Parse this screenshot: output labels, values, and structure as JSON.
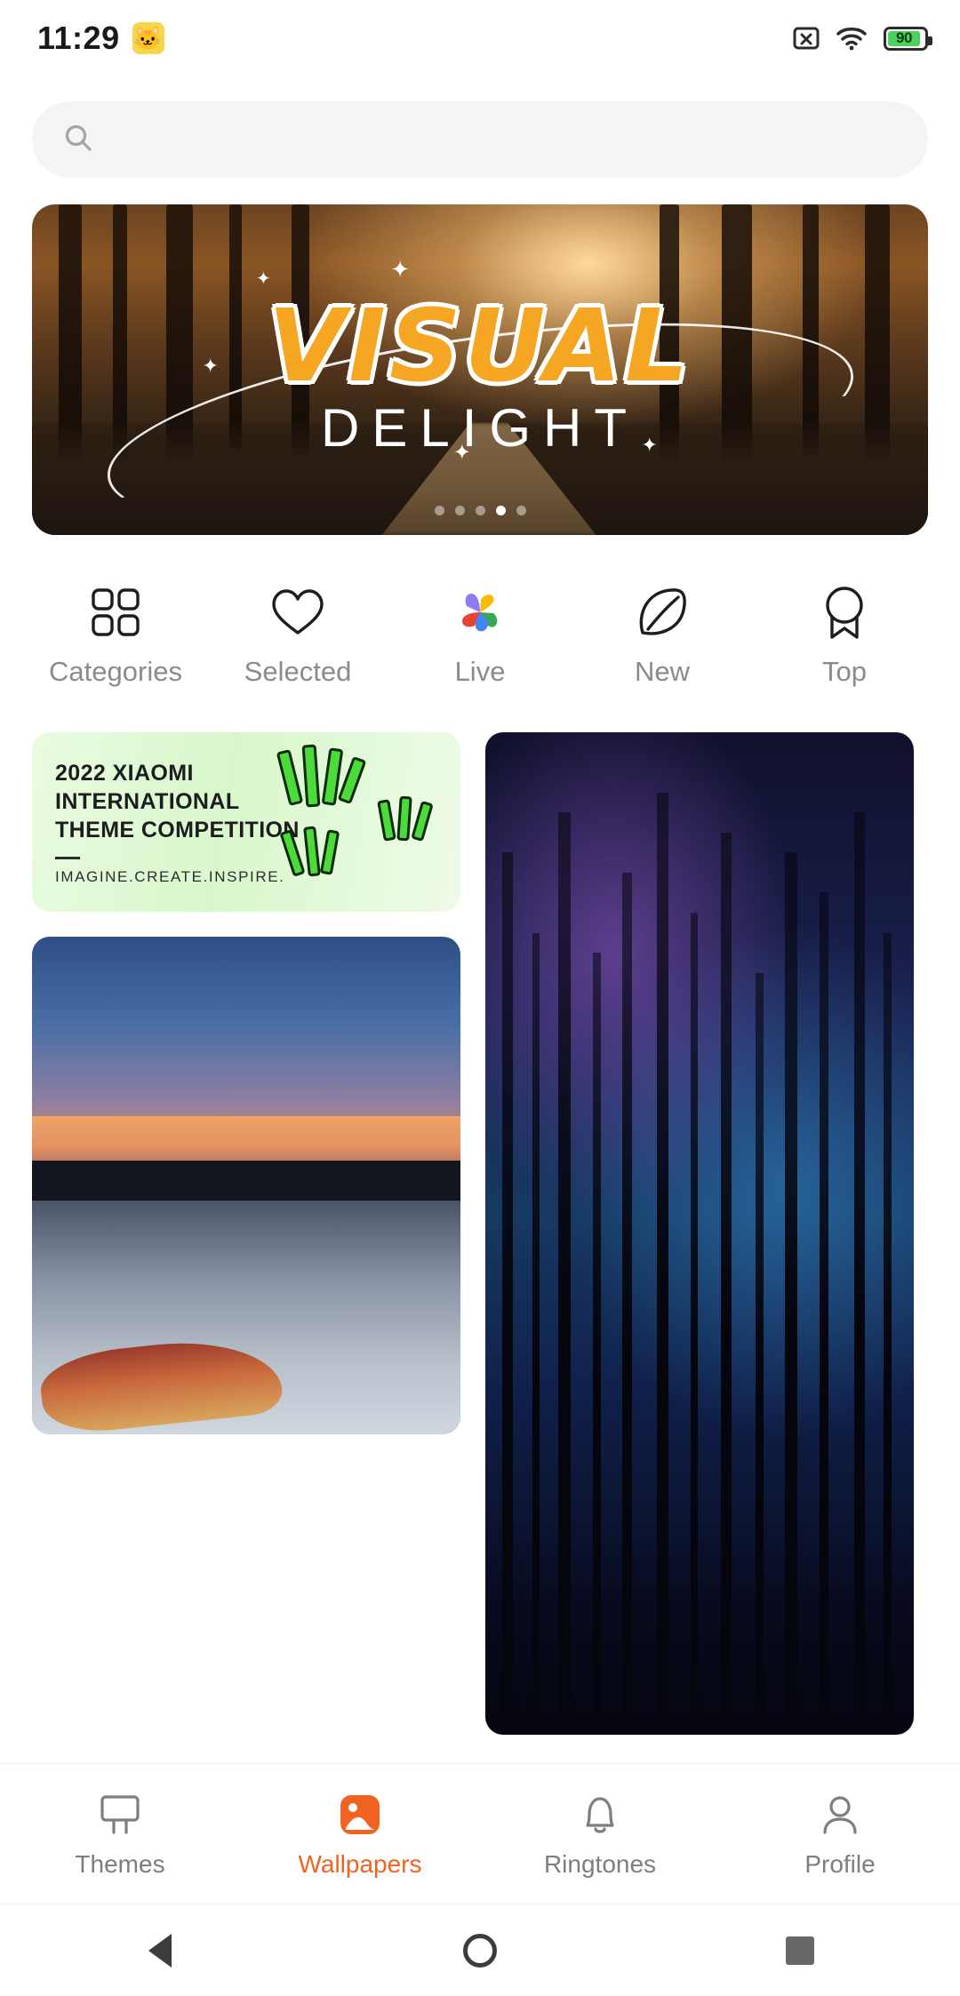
{
  "status_bar": {
    "time": "11:29",
    "emoji": "🐱",
    "battery_percent": "90",
    "icons": [
      "x-box-icon",
      "wifi-icon",
      "battery-icon"
    ]
  },
  "search": {
    "placeholder": "",
    "icon": "search-icon"
  },
  "banner": {
    "title_line1": "VISUAL",
    "title_line2": "DELIGHT",
    "dots_total": 5,
    "active_dot": 4
  },
  "categories": [
    {
      "label": "Categories",
      "icon": "grid-four-icon"
    },
    {
      "label": "Selected",
      "icon": "heart-icon"
    },
    {
      "label": "Live",
      "icon": "pinwheel-color-icon"
    },
    {
      "label": "New",
      "icon": "leaf-icon"
    },
    {
      "label": "Top",
      "icon": "ribbon-badge-icon"
    }
  ],
  "promo": {
    "title": "2022 XIAOMI INTERNATIONAL THEME COMPETITION",
    "subtitle": "IMAGINE.CREATE.INSPIRE."
  },
  "cards": [
    {
      "name": "lake-kayak-wallpaper"
    },
    {
      "name": "night-forest-wallpaper"
    }
  ],
  "bottom_nav": [
    {
      "label": "Themes",
      "icon": "themes-icon",
      "active": false
    },
    {
      "label": "Wallpapers",
      "icon": "wallpapers-icon",
      "active": true
    },
    {
      "label": "Ringtones",
      "icon": "bell-icon",
      "active": false
    },
    {
      "label": "Profile",
      "icon": "person-icon",
      "active": false
    }
  ],
  "system_nav": [
    {
      "name": "back-button",
      "icon": "triangle-back-icon"
    },
    {
      "name": "home-button",
      "icon": "circle-home-icon"
    },
    {
      "name": "recents-button",
      "icon": "square-recents-icon"
    }
  ],
  "colors": {
    "accent": "#f26322",
    "banner_title": "#f5a623",
    "muted_text": "#8a8a8f",
    "battery_green": "#4ad15e"
  }
}
